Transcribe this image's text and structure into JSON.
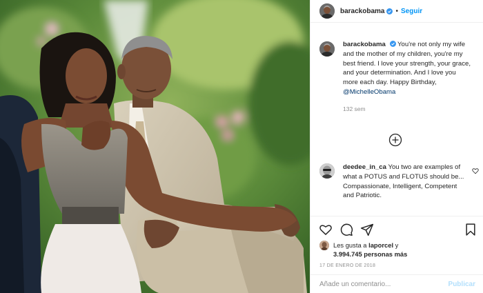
{
  "post": {
    "username": "barackobama",
    "verified": true,
    "follow_label": "Seguir",
    "separator": "•",
    "caption": {
      "username": "barackobama",
      "text": "You're not only my wife and the mother of my children, you're my best friend. I love your strength, your grace, and your determination. And I love you more each day. Happy Birthday,",
      "mention": "@MichelleObama",
      "time_ago": "132 sem"
    },
    "comment": {
      "username": "deedee_in_ca",
      "text": "You two are examples of what a POTUS and FLOTUS should be... Compassionate, Intelligent, Competent and Patriotic."
    },
    "likes": {
      "prefix": "Les gusta a",
      "user": "laporcel",
      "joiner": "y",
      "count_text": "3.994.745 personas más"
    },
    "date": "17 DE ENERO DE 2018",
    "comment_input": {
      "placeholder": "Añade un comentario...",
      "value": ""
    },
    "publish_label": "Publicar"
  },
  "icons": {
    "verified": "verified-badge-icon",
    "like": "heart-icon",
    "comment": "comment-bubble-icon",
    "share": "paper-plane-icon",
    "save": "bookmark-icon",
    "load_more": "plus-circle-icon"
  },
  "colors": {
    "link_blue": "#0095f6",
    "mention_blue": "#00376b",
    "muted_gray": "#8e8e8e",
    "publish_disabled": "#b2dffc",
    "divider": "#efefef"
  }
}
